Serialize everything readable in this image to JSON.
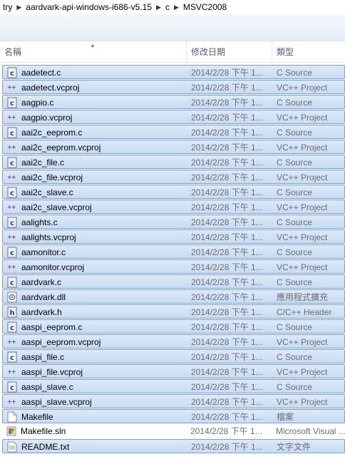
{
  "breadcrumb": {
    "items": [
      "try",
      "aardvark-api-windows-i686-v5.15",
      "c",
      "MSVC2008"
    ]
  },
  "columns": {
    "name": "名稱",
    "date": "修改日期",
    "type": "類型"
  },
  "files": [
    {
      "name": "aadetect.c",
      "date": "2014/2/28 下午 1...",
      "type": "C Source",
      "icon": "c-source-icon",
      "selected": true
    },
    {
      "name": "aadetect.vcproj",
      "date": "2014/2/28 下午 1...",
      "type": "VC++ Project",
      "icon": "vcproj-icon",
      "selected": true
    },
    {
      "name": "aagpio.c",
      "date": "2014/2/28 下午 1...",
      "type": "C Source",
      "icon": "c-source-icon",
      "selected": true
    },
    {
      "name": "aagpio.vcproj",
      "date": "2014/2/28 下午 1...",
      "type": "VC++ Project",
      "icon": "vcproj-icon",
      "selected": true
    },
    {
      "name": "aai2c_eeprom.c",
      "date": "2014/2/28 下午 1...",
      "type": "C Source",
      "icon": "c-source-icon",
      "selected": true
    },
    {
      "name": "aai2c_eeprom.vcproj",
      "date": "2014/2/28 下午 1...",
      "type": "VC++ Project",
      "icon": "vcproj-icon",
      "selected": true
    },
    {
      "name": "aai2c_file.c",
      "date": "2014/2/28 下午 1...",
      "type": "C Source",
      "icon": "c-source-icon",
      "selected": true
    },
    {
      "name": "aai2c_file.vcproj",
      "date": "2014/2/28 下午 1...",
      "type": "VC++ Project",
      "icon": "vcproj-icon",
      "selected": true
    },
    {
      "name": "aai2c_slave.c",
      "date": "2014/2/28 下午 1...",
      "type": "C Source",
      "icon": "c-source-icon",
      "selected": true
    },
    {
      "name": "aai2c_slave.vcproj",
      "date": "2014/2/28 下午 1...",
      "type": "VC++ Project",
      "icon": "vcproj-icon",
      "selected": true
    },
    {
      "name": "aalights.c",
      "date": "2014/2/28 下午 1...",
      "type": "C Source",
      "icon": "c-source-icon",
      "selected": true
    },
    {
      "name": "aalights.vcproj",
      "date": "2014/2/28 下午 1...",
      "type": "VC++ Project",
      "icon": "vcproj-icon",
      "selected": true
    },
    {
      "name": "aamonitor.c",
      "date": "2014/2/28 下午 1...",
      "type": "C Source",
      "icon": "c-source-icon",
      "selected": true
    },
    {
      "name": "aamonitor.vcproj",
      "date": "2014/2/28 下午 1...",
      "type": "VC++ Project",
      "icon": "vcproj-icon",
      "selected": true
    },
    {
      "name": "aardvark.c",
      "date": "2014/2/28 下午 1...",
      "type": "C Source",
      "icon": "c-source-icon",
      "selected": true
    },
    {
      "name": "aardvark.dll",
      "date": "2014/2/28 下午 1...",
      "type": "應用程式擴充",
      "icon": "dll-icon",
      "selected": true
    },
    {
      "name": "aardvark.h",
      "date": "2014/2/28 下午 1...",
      "type": "C/C++ Header",
      "icon": "header-icon",
      "selected": true
    },
    {
      "name": "aaspi_eeprom.c",
      "date": "2014/2/28 下午 1...",
      "type": "C Source",
      "icon": "c-source-icon",
      "selected": true
    },
    {
      "name": "aaspi_eeprom.vcproj",
      "date": "2014/2/28 下午 1...",
      "type": "VC++ Project",
      "icon": "vcproj-icon",
      "selected": true
    },
    {
      "name": "aaspi_file.c",
      "date": "2014/2/28 下午 1...",
      "type": "C Source",
      "icon": "c-source-icon",
      "selected": true
    },
    {
      "name": "aaspi_file.vcproj",
      "date": "2014/2/28 下午 1...",
      "type": "VC++ Project",
      "icon": "vcproj-icon",
      "selected": true
    },
    {
      "name": "aaspi_slave.c",
      "date": "2014/2/28 下午 1...",
      "type": "C Source",
      "icon": "c-source-icon",
      "selected": true
    },
    {
      "name": "aaspi_slave.vcproj",
      "date": "2014/2/28 下午 1...",
      "type": "VC++ Project",
      "icon": "vcproj-icon",
      "selected": true
    },
    {
      "name": "Makefile",
      "date": "2014/2/28 下午 1...",
      "type": "檔案",
      "icon": "file-icon",
      "selected": true
    },
    {
      "name": "Makefile.sln",
      "date": "2014/2/28 下午 1...",
      "type": "Microsoft Visual ...",
      "icon": "sln-icon",
      "selected": false
    },
    {
      "name": "README.txt",
      "date": "2014/2/28 下午 1...",
      "type": "文字文件",
      "icon": "text-file-icon",
      "selected": true
    }
  ],
  "colors": {
    "selection_fill": "#cfe0f5",
    "selection_border": "#7da2ce",
    "header_text": "#4c607a",
    "dim_text": "#6d6d6d"
  }
}
